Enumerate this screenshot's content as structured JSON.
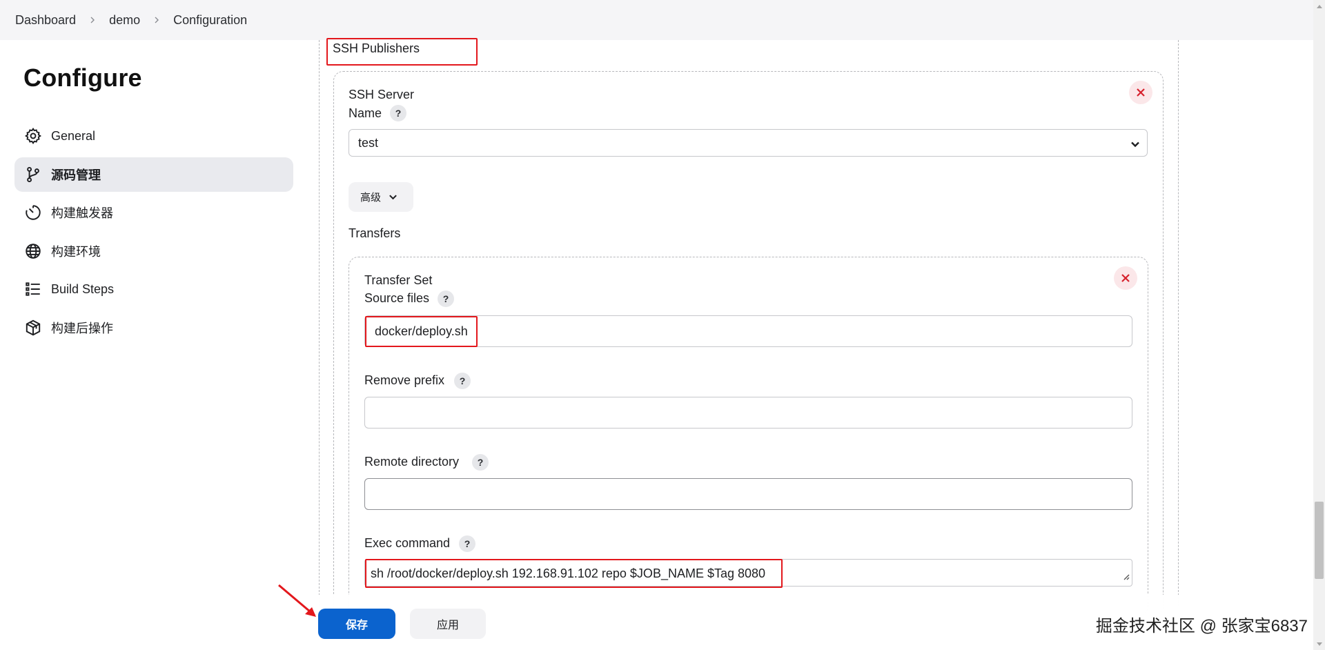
{
  "breadcrumb": {
    "items": [
      "Dashboard",
      "demo",
      "Configuration"
    ]
  },
  "page_title": "Configure",
  "sidebar": {
    "items": [
      {
        "label": "General",
        "icon": "gear-icon"
      },
      {
        "label": "源码管理",
        "icon": "branch-icon",
        "active": true
      },
      {
        "label": "构建触发器",
        "icon": "timer-icon"
      },
      {
        "label": "构建环境",
        "icon": "globe-icon"
      },
      {
        "label": "Build Steps",
        "icon": "list-icon"
      },
      {
        "label": "构建后操作",
        "icon": "box-icon"
      }
    ]
  },
  "publishers": {
    "section_label": "SSH Publishers",
    "server": {
      "heading": "SSH Server",
      "name_label": "Name",
      "name_value": "test",
      "advanced_label": "高级",
      "transfers_label": "Transfers"
    },
    "transfer_set": {
      "heading": "Transfer Set",
      "source_files_label": "Source files",
      "source_files_value": "docker/deploy.sh",
      "remove_prefix_label": "Remove prefix",
      "remove_prefix_value": "",
      "remote_directory_label": "Remote directory",
      "remote_directory_value": "",
      "exec_command_label": "Exec command",
      "exec_command_value": "sh /root/docker/deploy.sh 192.168.91.102 repo $JOB_NAME $Tag 8080"
    },
    "help_glyph": "?"
  },
  "actions": {
    "save_label": "保存",
    "apply_label": "应用"
  },
  "watermark": "掘金技术社区 @ 张家宝6837",
  "colors": {
    "primary": "#0b63ce",
    "highlight_box": "#e3171c",
    "danger_bg": "#fbe7e9",
    "danger": "#d6202c"
  }
}
